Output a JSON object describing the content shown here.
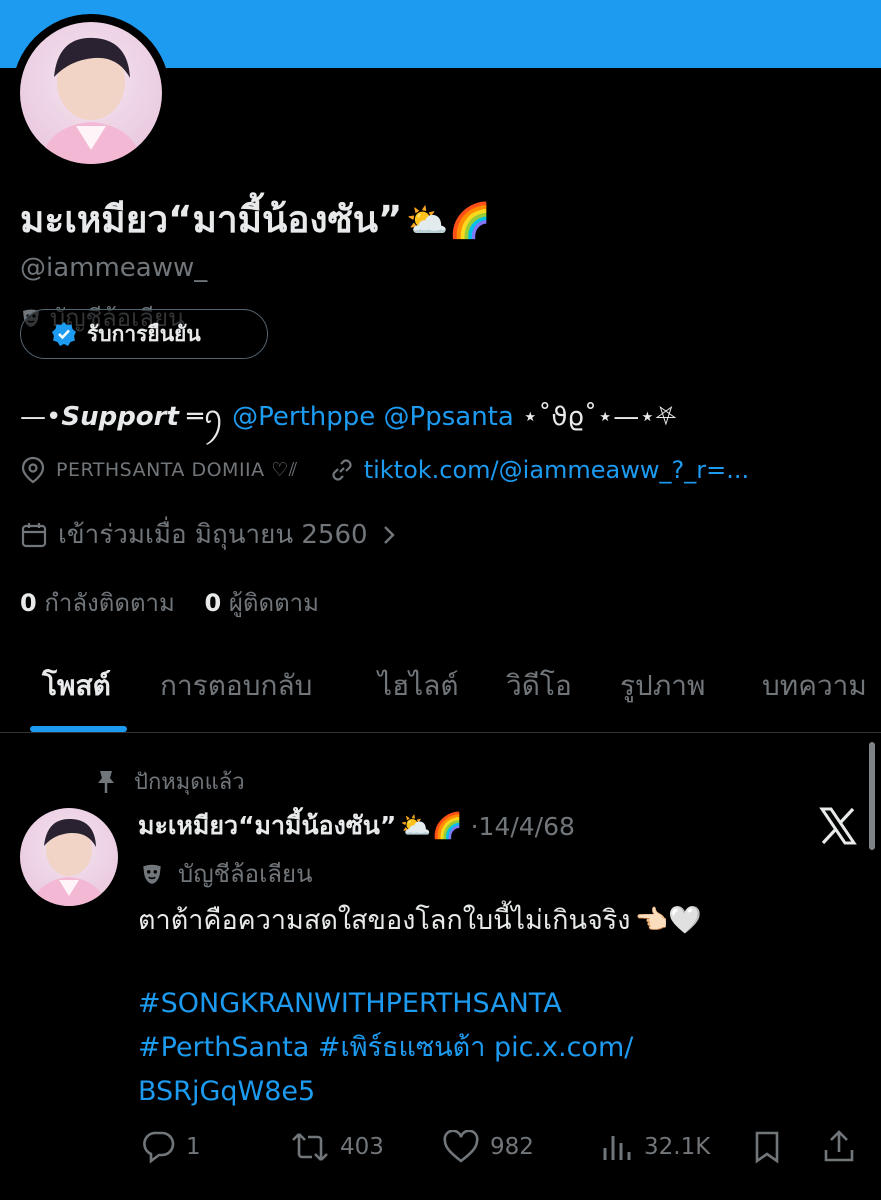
{
  "profile": {
    "display_name": "มะเหมียว“มามี้น้องซัน”",
    "name_emojis": "⛅🌈",
    "handle": "@iammeaww_",
    "parody_label": "บัญชีล้อเลียน",
    "verify_button": "รับการยืนยัน",
    "bio": {
      "prefix": "—•",
      "support": "Support",
      "mid": " ═ꪆ ",
      "mention1": "@Perthppe",
      "mention2": "@Ppsanta",
      "suffix": " ⋆˚ϑϱ˚⋆—⋆⛧"
    },
    "location": "PERTHSANTA DOMIIA ♡⫽",
    "website": "tiktok.com/@iammeaww_?_r=...",
    "joined": "เข้าร่วมเมื่อ มิถุนายน 2560",
    "following_count": "0",
    "following_label": "กำลังติดตาม",
    "followers_count": "0",
    "followers_label": "ผู้ติดตาม"
  },
  "tabs": [
    "โพสต์",
    "การตอบกลับ",
    "ไฮไลต์",
    "วิดีโอ",
    "รูปภาพ",
    "บทความ"
  ],
  "tweet": {
    "pinned_label": "ปักหมุดแล้ว",
    "author": "มะเหมียว“มามี้น้องซัน”",
    "author_emojis": "⛅🌈",
    "dot": "·",
    "date": "14/4/68",
    "parody_label": "บัญชีล้อเลียน",
    "text": "ตาต้าคือความสดใสของโลกใบนี้ไม่เกินจริง",
    "text_emojis": "👈🏻🤍",
    "hashtag1": " #SONGKRANWITHPERTHSANTA",
    "hashtag2": "#PerthSanta #เพิร์ธแซนต้า pic.x.com/",
    "hashtag3": "BSRjGqW8e5",
    "replies": "1",
    "reposts": "403",
    "likes": "982",
    "views": "32.1K"
  },
  "colors": {
    "accent": "#1d9bf0",
    "background": "#000000",
    "text_primary": "#e7e9ea",
    "text_secondary": "#71767b"
  },
  "icons": [
    "location-icon",
    "link-icon",
    "calendar-icon",
    "pin-icon",
    "verified-icon",
    "parody-mask-icon",
    "x-logo-icon",
    "reply-icon",
    "repost-icon",
    "like-icon",
    "views-icon",
    "bookmark-icon",
    "share-icon"
  ]
}
